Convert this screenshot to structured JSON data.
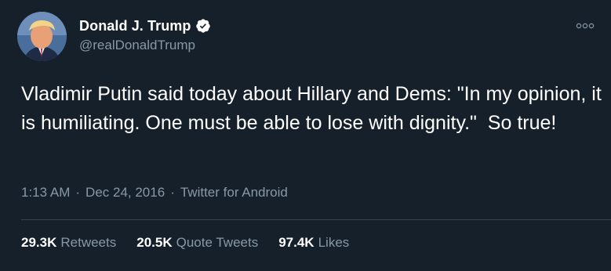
{
  "user": {
    "display_name": "Donald J. Trump",
    "handle": "@realDonaldTrump",
    "verified": true,
    "verified_icon": "verified-badge-icon"
  },
  "tweet": {
    "text": "Vladimir Putin said today about Hillary and Dems: \"In my opinion, it is humiliating. One must be able to lose with dignity.\"  So true!",
    "time": "1:13 AM",
    "date": "Dec 24, 2016",
    "source": "Twitter for Android",
    "separator": "·"
  },
  "stats": {
    "retweets_value": "29.3K",
    "retweets_label": "Retweets",
    "quotes_value": "20.5K",
    "quotes_label": "Quote Tweets",
    "likes_value": "97.4K",
    "likes_label": "Likes"
  },
  "colors": {
    "background": "#15202b",
    "primary_text": "#ffffff",
    "secondary_text": "#8899a6",
    "divider": "#38444d",
    "verified": "#ffffff"
  }
}
